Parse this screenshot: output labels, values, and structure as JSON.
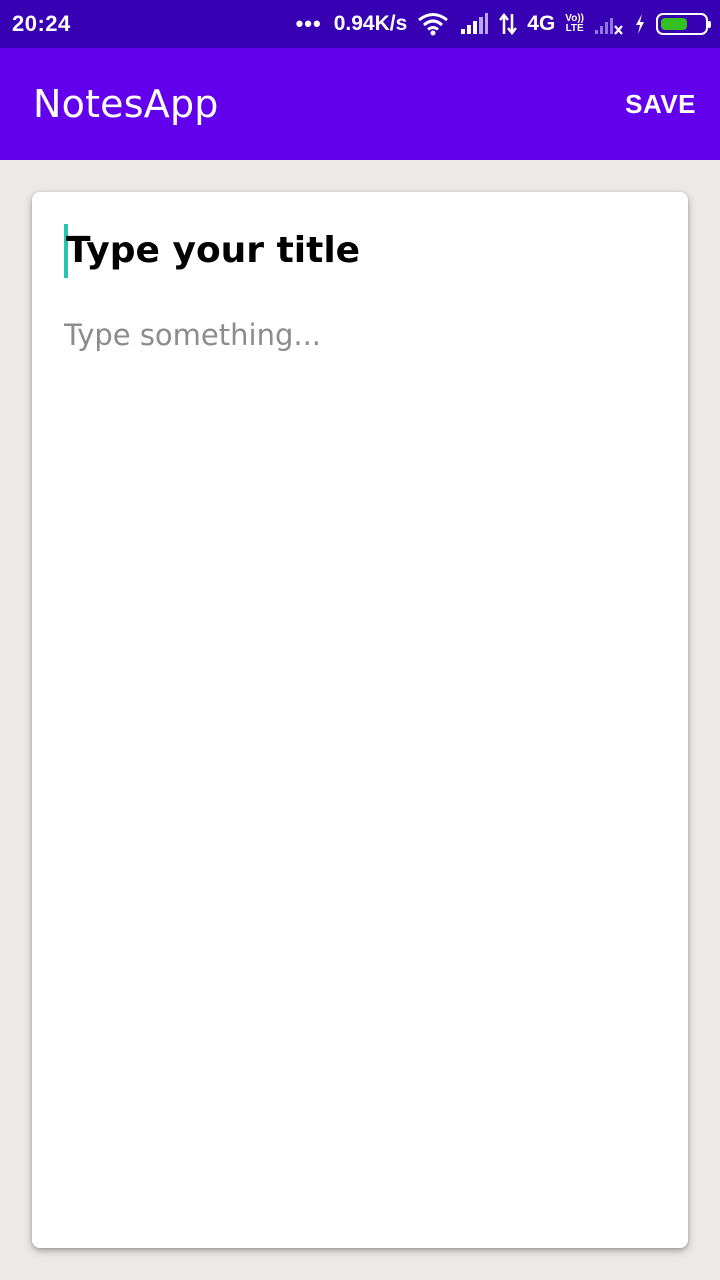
{
  "status_bar": {
    "time": "20:24",
    "net_speed": "0.94K/s",
    "network_type": "4G",
    "volte_top": "Vo))",
    "volte_bottom": "LTE",
    "battery_color": "#35c021",
    "icons": [
      "wifi-icon",
      "signal-icon",
      "data-arrows-icon",
      "volte-icon",
      "signal-no-service-icon",
      "charging-icon",
      "battery-icon"
    ]
  },
  "app_bar": {
    "title": "NotesApp",
    "save_label": "SAVE",
    "color": "#6200ee"
  },
  "editor": {
    "title_placeholder": "Type your title",
    "title_value": "",
    "body_placeholder": "Type something...",
    "body_value": "",
    "cursor_color": "#26c6b3"
  }
}
